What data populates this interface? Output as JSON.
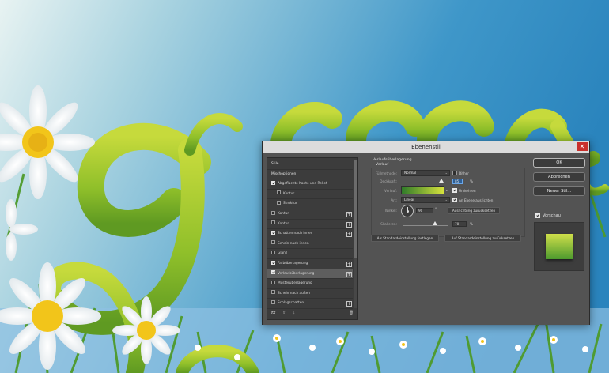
{
  "dialog": {
    "title": "Ebenenstil",
    "close_glyph": "✕"
  },
  "styles_panel": {
    "items": [
      {
        "label": "Stile",
        "checkbox": false,
        "checked": false,
        "plus": false,
        "indent": false
      },
      {
        "label": "Mischoptionen",
        "checkbox": false,
        "checked": false,
        "plus": false,
        "indent": false
      },
      {
        "label": "Abgeflachte Kante und Relief",
        "checkbox": true,
        "checked": true,
        "plus": false,
        "indent": false
      },
      {
        "label": "Kontur",
        "checkbox": true,
        "checked": false,
        "plus": false,
        "indent": true
      },
      {
        "label": "Struktur",
        "checkbox": true,
        "checked": false,
        "plus": false,
        "indent": true
      },
      {
        "label": "Kontur",
        "checkbox": true,
        "checked": false,
        "plus": true,
        "indent": false
      },
      {
        "label": "Kontur",
        "checkbox": true,
        "checked": false,
        "plus": true,
        "indent": false
      },
      {
        "label": "Schatten nach innen",
        "checkbox": true,
        "checked": true,
        "plus": true,
        "indent": false
      },
      {
        "label": "Schein nach innen",
        "checkbox": true,
        "checked": false,
        "plus": false,
        "indent": false
      },
      {
        "label": "Glanz",
        "checkbox": true,
        "checked": false,
        "plus": false,
        "indent": false
      },
      {
        "label": "Farbüberlagerung",
        "checkbox": true,
        "checked": true,
        "plus": true,
        "indent": false
      },
      {
        "label": "Verlaufsüberlagerung",
        "checkbox": true,
        "checked": true,
        "plus": true,
        "indent": false,
        "selected": true
      },
      {
        "label": "Musterüberlagerung",
        "checkbox": true,
        "checked": false,
        "plus": false,
        "indent": false
      },
      {
        "label": "Schein nach außen",
        "checkbox": true,
        "checked": false,
        "plus": false,
        "indent": false
      },
      {
        "label": "Schlagschatten",
        "checkbox": true,
        "checked": false,
        "plus": true,
        "indent": false
      }
    ],
    "plus_glyph": "+",
    "footer": {
      "fx": "fx",
      "up": "⇧",
      "down": "⇩",
      "trash": "🗑"
    }
  },
  "settings": {
    "section_title": "Verlaufsüberlagerung",
    "subsection_title": "Verlauf",
    "blend_mode_label": "Füllmethode:",
    "blend_mode_value": "Normal",
    "dither_label": "Dither",
    "opacity_label": "Deckkraft:",
    "opacity_value": "85",
    "opacity_fraction": 0.85,
    "percent": "%",
    "gradient_label": "Verlauf:",
    "reverse_label": "Umkehren",
    "style_label": "Art:",
    "style_value": "Linear",
    "align_label": "An Ebene ausrichten",
    "angle_label": "Winkel:",
    "angle_value": "90",
    "degree": "°",
    "reset_align_button": "Ausrichtung zurücksetzen",
    "scale_label": "Skalieren:",
    "scale_value": "70",
    "scale_fraction": 0.7,
    "make_default_button": "Als Standardeinstellung festlegen",
    "reset_default_button": "Auf Standardeinstellung zurücksetzen",
    "caret": "⌄"
  },
  "right_panel": {
    "ok_button": "OK",
    "cancel_button": "Abbrechen",
    "new_style_button": "Neuer Stil...",
    "preview_label": "Vorschau"
  },
  "colors": {
    "dialog_bg": "#535353",
    "panel_bg": "#3c3c3c",
    "close_red": "#c9302c",
    "gradient_start": "#2f7a2a",
    "gradient_end": "#d6e23d"
  }
}
